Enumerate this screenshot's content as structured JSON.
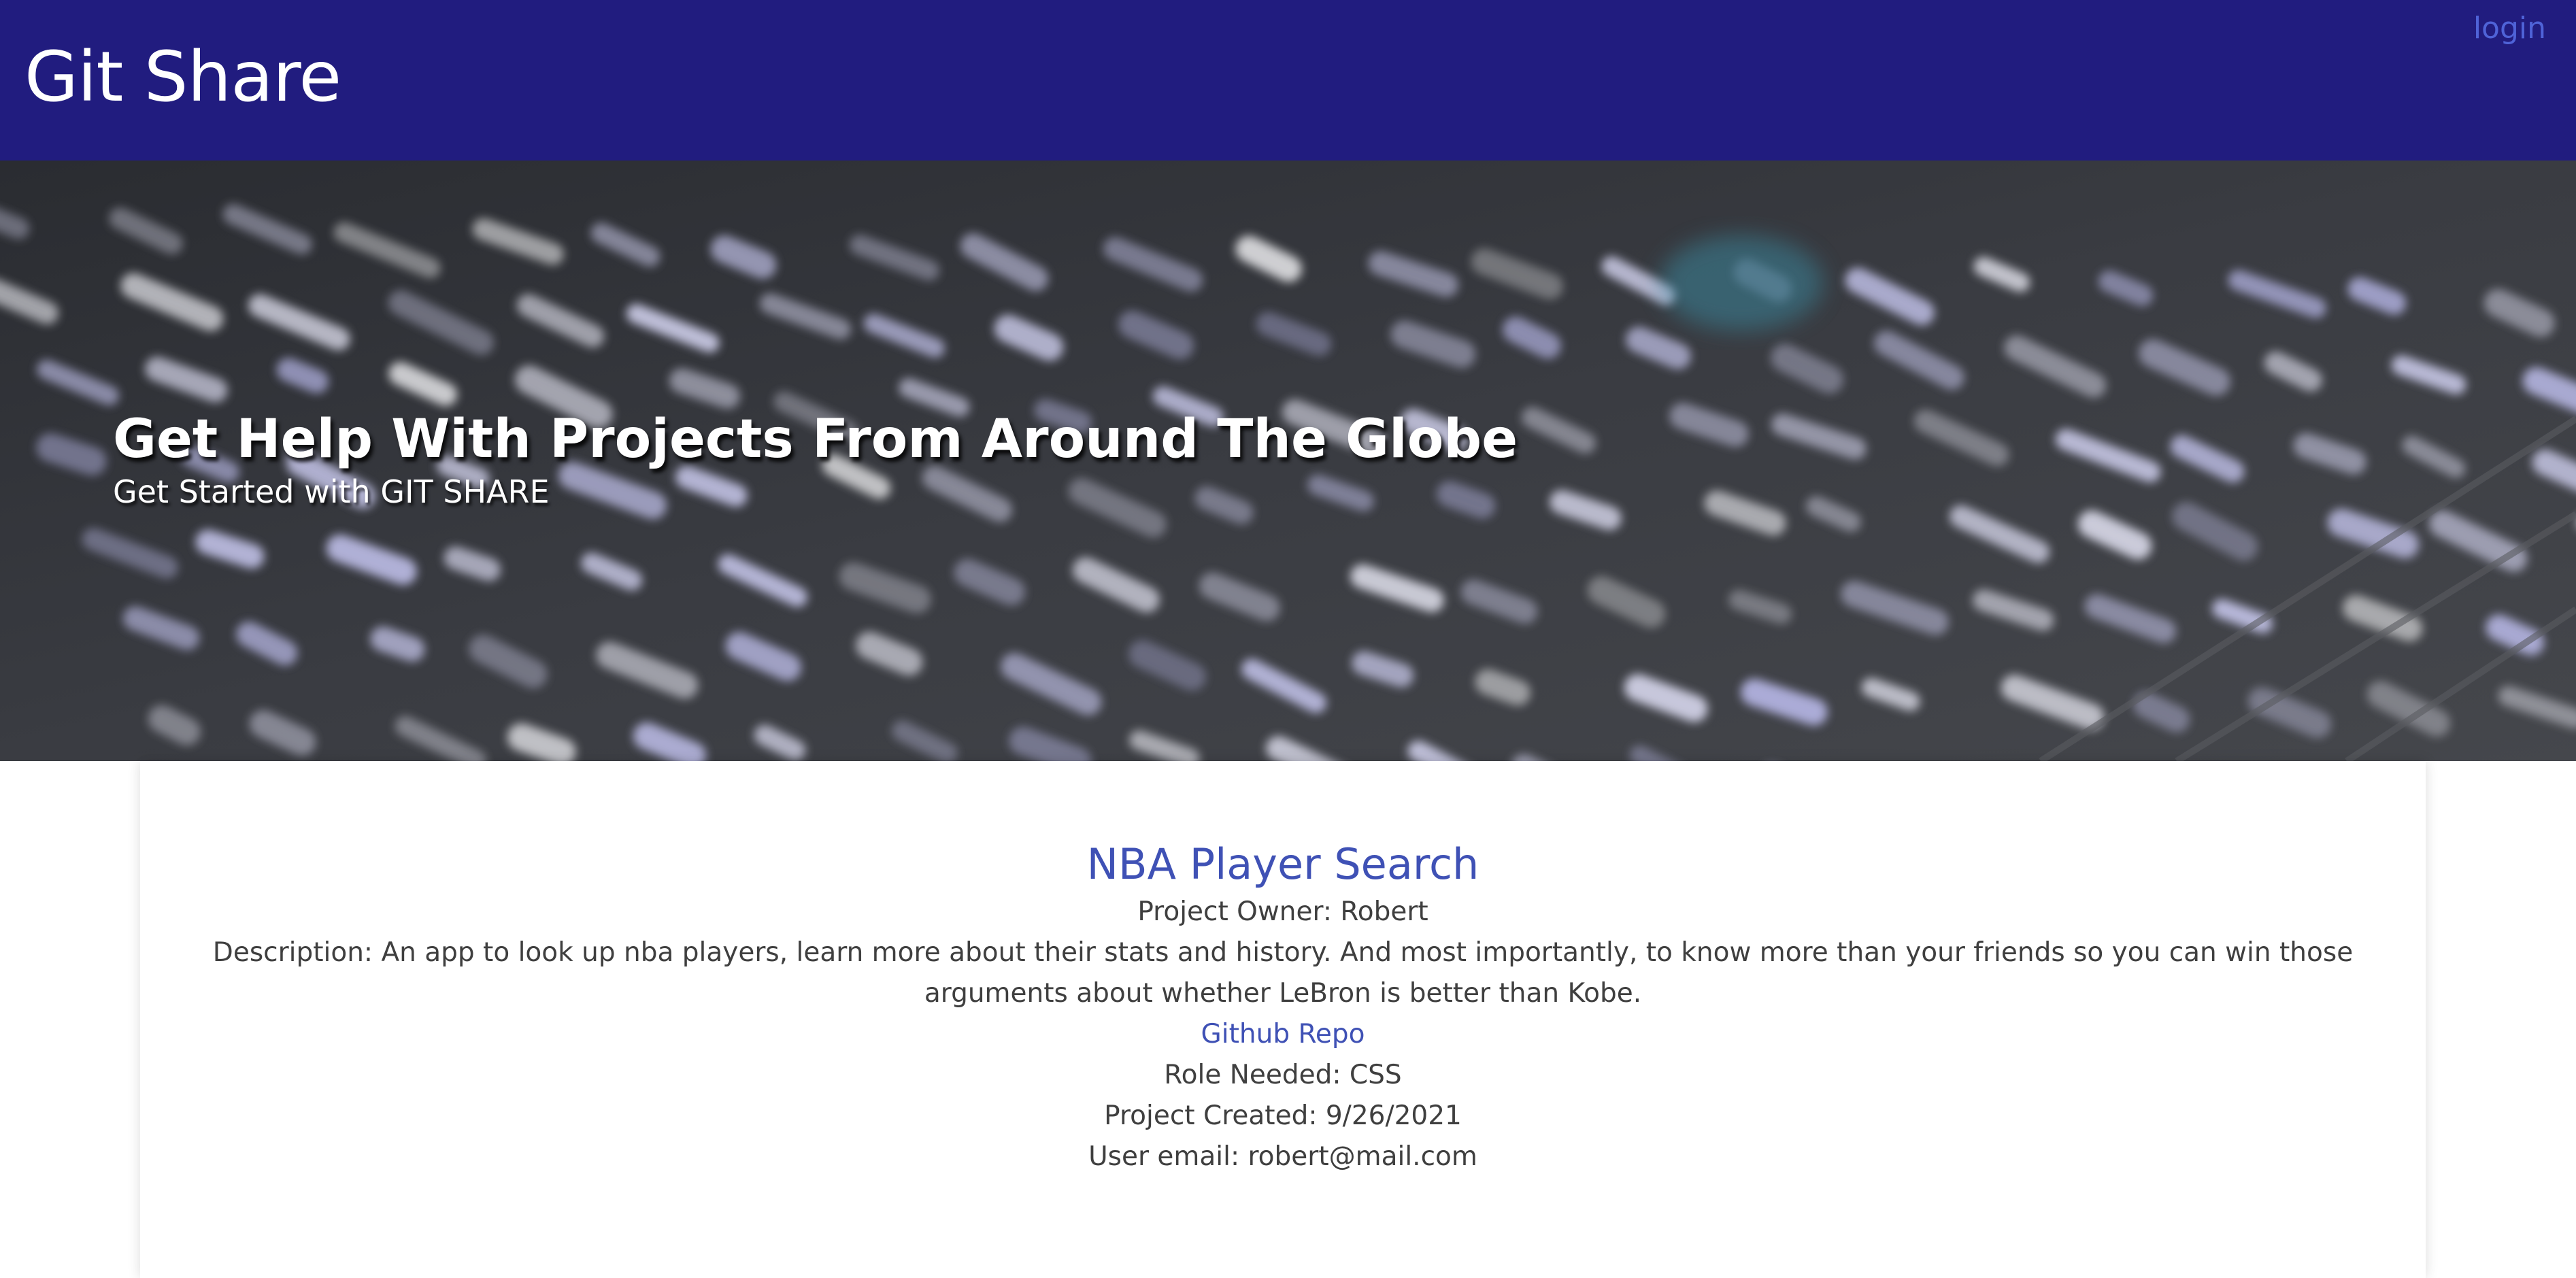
{
  "header": {
    "brand": "Git Share",
    "login_label": "login",
    "background_color": "#211c7f",
    "link_color": "#4f63d8"
  },
  "hero": {
    "title": "Get Help With Projects From Around The Globe",
    "subtitle": "Get Started with GIT SHARE",
    "background_image": "keyboard-photo"
  },
  "project": {
    "title": "NBA Player Search",
    "owner": "Project Owner: Robert",
    "description": "Description: An app to look up nba players, learn more about their stats and history. And most importantly, to know more than your friends so you can win those arguments about whether LeBron is better than Kobe.",
    "repo_link_label": "Github Repo",
    "role_needed": "Role Needed: CSS",
    "created": "Project Created: 9/26/2021",
    "user_email": "User email: robert@mail.com",
    "accent_color": "#3f51b5"
  }
}
